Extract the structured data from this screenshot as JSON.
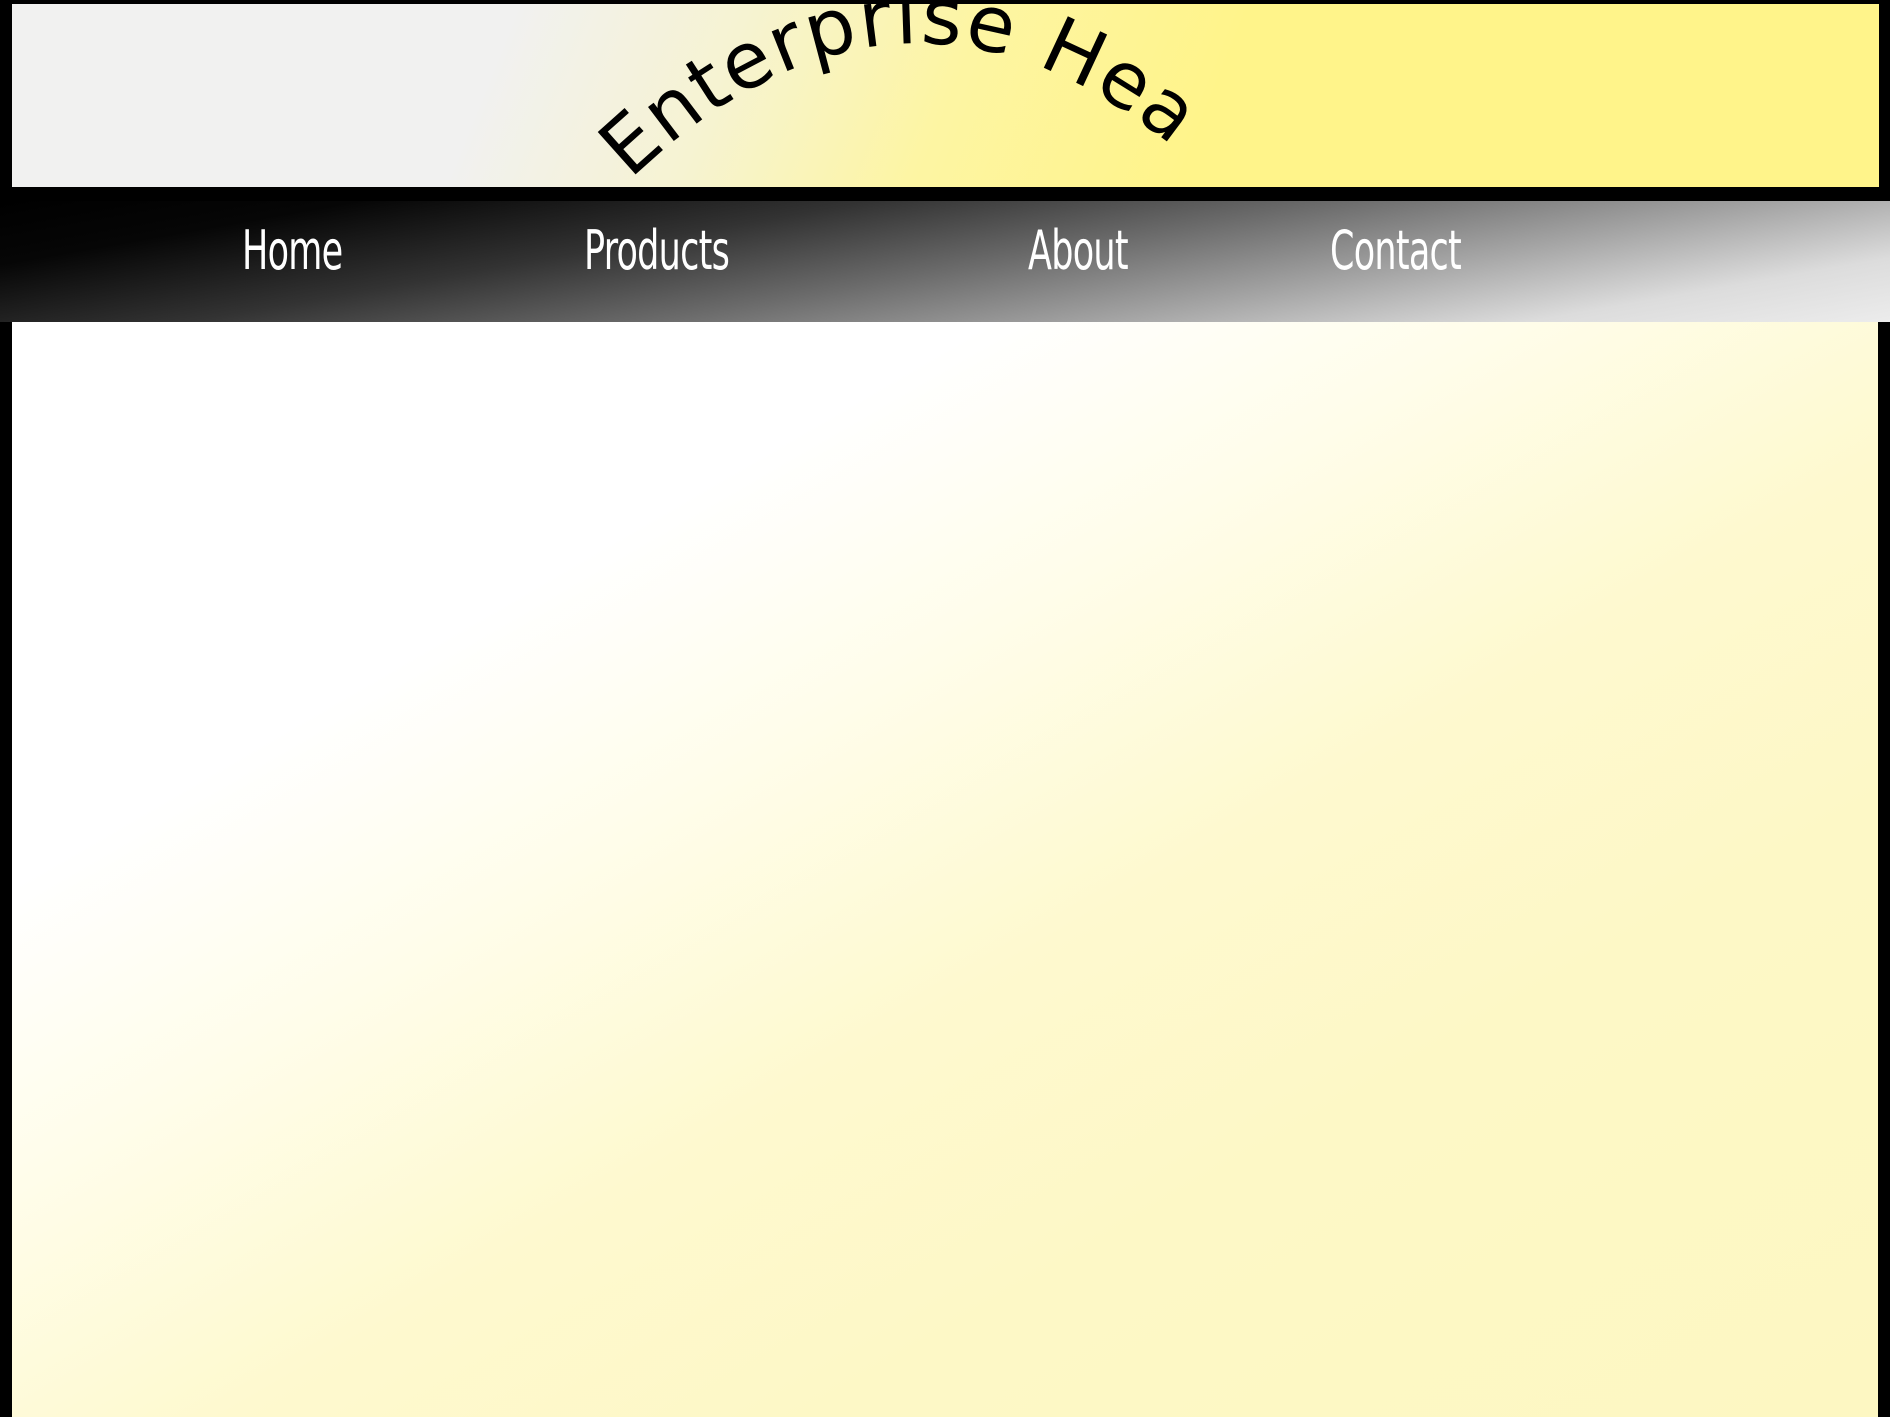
{
  "header": {
    "title": "Enterprise Header"
  },
  "nav": {
    "items": [
      {
        "label": "Home"
      },
      {
        "label": "Products"
      },
      {
        "label": "About"
      },
      {
        "label": "Contact"
      }
    ]
  },
  "colors": {
    "frame": "#000000",
    "header_left": "#f1f1f0",
    "header_right": "#fff48a",
    "nav_dark": "#000000",
    "nav_light": "#ececec",
    "nav_text": "#ffffff",
    "content_light": "#ffffff",
    "content_warm": "#fdf7c2"
  }
}
